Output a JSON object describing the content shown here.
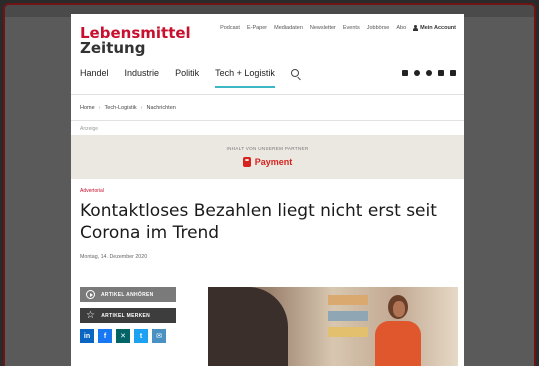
{
  "site": {
    "logo_line1": "Lebensmittel",
    "logo_line2": "Zeitung",
    "colors": {
      "brand": "#c8102e",
      "accent": "#3bb8c4",
      "partner": "#d6231e"
    }
  },
  "topnav": {
    "items": [
      "Podcast",
      "E-Paper",
      "Mediadaten",
      "Newsletter",
      "Events",
      "Jobbörse",
      "Abo"
    ],
    "account": "Mein Account"
  },
  "mainnav": {
    "items": [
      "Handel",
      "Industrie",
      "Politik",
      "Tech + Logistik"
    ],
    "active": "Tech + Logistik"
  },
  "social_icons": [
    "linkedin-icon",
    "facebook-icon",
    "instagram-icon",
    "twitter-icon",
    "rss-icon"
  ],
  "breadcrumb": [
    "Home",
    "Tech-Logistik",
    "Nachrichten"
  ],
  "ad_label": "Anzeige",
  "partner": {
    "label": "INHALT VON UNSEREM PARTNER",
    "name": "Payment"
  },
  "article": {
    "kicker": "Advertorial",
    "title": "Kontaktloses Bezahlen liegt nicht erst seit Corona im Trend",
    "date": "Montag, 14. Dezember 2020",
    "listen_label": "ARTIKEL ANHÖREN",
    "save_label": "ARTIKEL MERKEN"
  },
  "share_buttons": [
    {
      "icon": "linkedin-icon",
      "glyph": "in",
      "color": "#0a66c2"
    },
    {
      "icon": "facebook-icon",
      "glyph": "f",
      "color": "#1877f2"
    },
    {
      "icon": "xing-icon",
      "glyph": "✕",
      "color": "#026466"
    },
    {
      "icon": "twitter-icon",
      "glyph": "t",
      "color": "#1da1f2"
    },
    {
      "icon": "email-icon",
      "glyph": "✉",
      "color": "#4a90c2"
    }
  ]
}
